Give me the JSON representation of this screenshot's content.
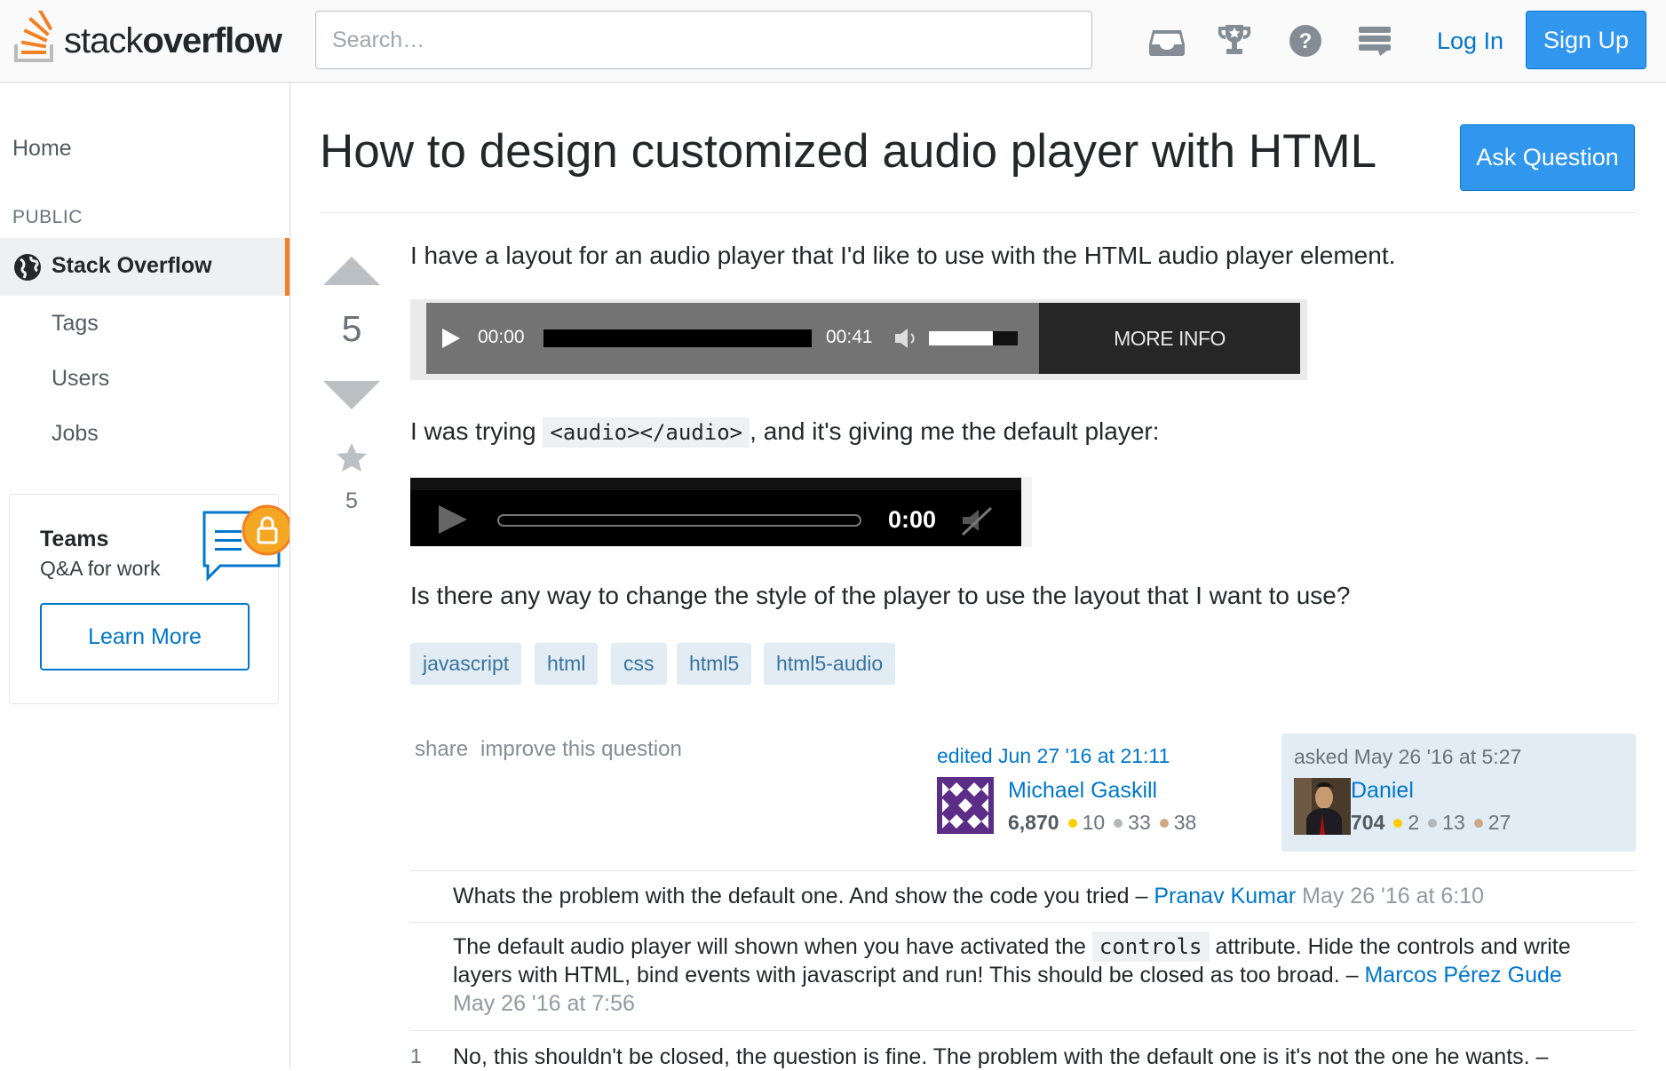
{
  "header": {
    "logo_word_light": "stack",
    "logo_word_bold": "overflow",
    "search_placeholder": "Search…",
    "icons": [
      "inbox-icon",
      "achievements-icon",
      "help-icon",
      "site-switcher-icon"
    ],
    "login_label": "Log In",
    "signup_label": "Sign Up"
  },
  "sidebar": {
    "home": "Home",
    "section": "PUBLIC",
    "current": "Stack Overflow",
    "items": [
      "Tags",
      "Users",
      "Jobs"
    ],
    "teams": {
      "title": "Teams",
      "subtitle": "Q&A for work",
      "button": "Learn More"
    }
  },
  "question": {
    "title": "How to design customized audio player with HTML",
    "ask_button": "Ask Question",
    "votes": "5",
    "favorites": "5",
    "para1": "I have a layout for an audio player that I'd like to use with the HTML audio player element.",
    "player1": {
      "time_start": "00:00",
      "time_end": "00:41",
      "more_info": "MORE INFO"
    },
    "para2_before": "I was trying",
    "para2_code": "<audio></audio>",
    "para2_after": ", and it's giving me the default player:",
    "player2": {
      "time": "0:00"
    },
    "para3": "Is there any way to change the style of the player to use the layout that I want to use?",
    "tags": [
      "javascript",
      "html",
      "css",
      "html5",
      "html5-audio"
    ],
    "share": "share",
    "improve": "improve this question",
    "edited": {
      "label": "edited Jun 27 '16 at 21:11",
      "user": "Michael Gaskill",
      "rep": "6,870",
      "gold": "10",
      "silver": "33",
      "bronze": "38"
    },
    "asked": {
      "label": "asked May 26 '16 at 5:27",
      "user": "Daniel",
      "rep": "704",
      "gold": "2",
      "silver": "13",
      "bronze": "27"
    }
  },
  "comments": [
    {
      "text": "Whats the problem with the default one. And show the code you tried –",
      "user": "Pranav Kumar",
      "time": "May 26 '16 at 6:10"
    },
    {
      "text_before": "The default audio player will shown when you have activated the",
      "code": "controls",
      "text_after": "attribute. Hide the controls and write layers with HTML, bind events with javascript and run! This should be closed as too broad. –",
      "user": "Marcos Pérez Gude",
      "time": "May 26 '16 at 7:56"
    },
    {
      "score": "1",
      "text": "No, this shouldn't be closed, the question is fine. The problem with the default one is it's not the one he wants. –"
    }
  ],
  "colors": {
    "accent": "#3197ee",
    "link": "#0077cc",
    "brand_orange": "#f48024",
    "tag_bg": "#e1ecf4",
    "tag_text": "#39739d"
  }
}
